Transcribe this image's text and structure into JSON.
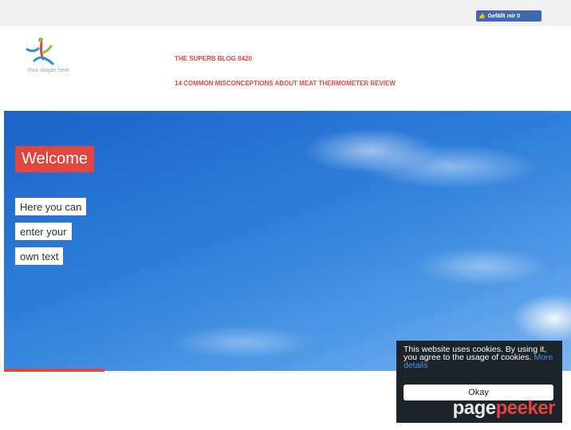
{
  "facebook": {
    "like_label": "Gefällt mir 0",
    "like_color": "#4267b2",
    "thumb_icon": "thumbs-up-icon"
  },
  "header": {
    "slogan": "Your slogan here",
    "blog_title": "THE SUPERB BLOG 8420",
    "post_title": "14 COMMON MISCONCEPTIONS ABOUT MEAT THERMOMETER REVIEW",
    "accent_color": "#e2443f"
  },
  "hero": {
    "welcome": "Welcome",
    "lines": [
      "Here you can",
      "enter your",
      "own text"
    ]
  },
  "cookie": {
    "message": "This website uses cookies. By using it, you agree to the usage of cookies.",
    "link": "More details",
    "button": "Okay"
  },
  "watermark": {
    "part1": "page",
    "part2": "peeker"
  }
}
